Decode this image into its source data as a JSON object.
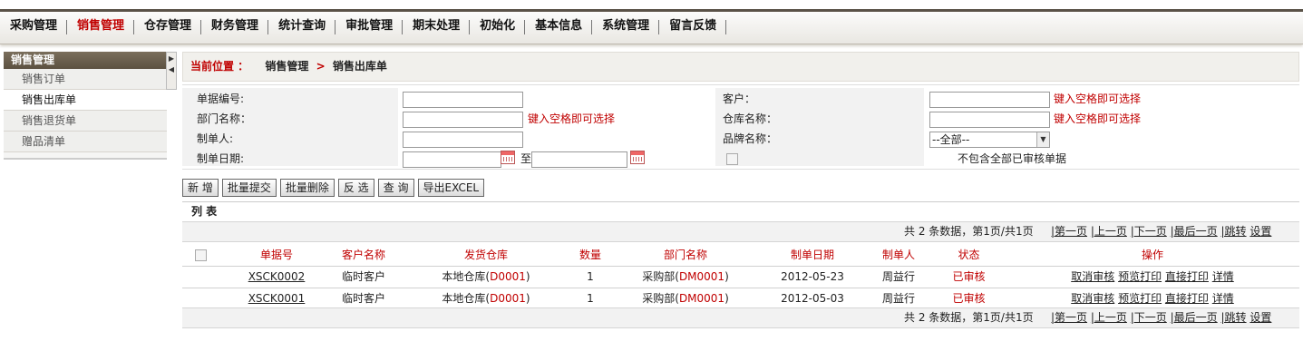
{
  "nav": {
    "items": [
      "采购管理",
      "销售管理",
      "仓存管理",
      "财务管理",
      "统计查询",
      "审批管理",
      "期末处理",
      "初始化",
      "基本信息",
      "系统管理",
      "留言反馈"
    ],
    "active_index": 1
  },
  "sidebar": {
    "title": "销售管理",
    "items": [
      "销售订单",
      "销售出库单",
      "销售退货单",
      "赠品清单"
    ],
    "current_index": 1
  },
  "breadcrumb": {
    "label": "当前位置 ：",
    "section": "销售管理",
    "arrow": ">",
    "page": "销售出库单"
  },
  "search": {
    "doc_no_label": "单据编号:",
    "dept_label": "部门名称：",
    "creator_label": "制单人:",
    "date_label": "制单日期:",
    "date_to": "至",
    "customer_label": "客户：",
    "warehouse_label": "仓库名称：",
    "brand_label": "品牌名称：",
    "brand_selected": "--全部--",
    "hint": "键入空格即可选择",
    "exclude_label": "不包含全部已审核单据"
  },
  "toolbar": {
    "add": "新 增",
    "batch_submit": "批量提交",
    "batch_delete": "批量删除",
    "invert": "反 选",
    "query": "查 询",
    "export": "导出EXCEL"
  },
  "list": {
    "title": "列 表",
    "pager_info": "共 2 条数据，第1页/共1页",
    "pager_links": [
      "|第一页",
      "|上一页",
      "|下一页",
      "|最后一页",
      "|跳转",
      "设置"
    ],
    "columns": [
      "单据号",
      "客户名称",
      "发货仓库",
      "数量",
      "部门名称",
      "制单日期",
      "制单人",
      "状态",
      "操作"
    ],
    "rows": [
      {
        "doc_no": "XSCK0002",
        "customer": "临时客户",
        "warehouse": "本地仓库",
        "warehouse_code": "D0001",
        "qty": "1",
        "dept": "采购部",
        "dept_code": "DM0001",
        "date": "2012-05-23",
        "creator": "周益行",
        "status": "已审核"
      },
      {
        "doc_no": "XSCK0001",
        "customer": "临时客户",
        "warehouse": "本地仓库",
        "warehouse_code": "D0001",
        "qty": "1",
        "dept": "采购部",
        "dept_code": "DM0001",
        "date": "2012-05-03",
        "creator": "周益行",
        "status": "已审核"
      }
    ],
    "actions": [
      "取消审核",
      "预览打印",
      "直接打印",
      "详情"
    ]
  },
  "colors": {
    "accent_red": "#c00000",
    "sidebar_head": "#6b604e"
  }
}
